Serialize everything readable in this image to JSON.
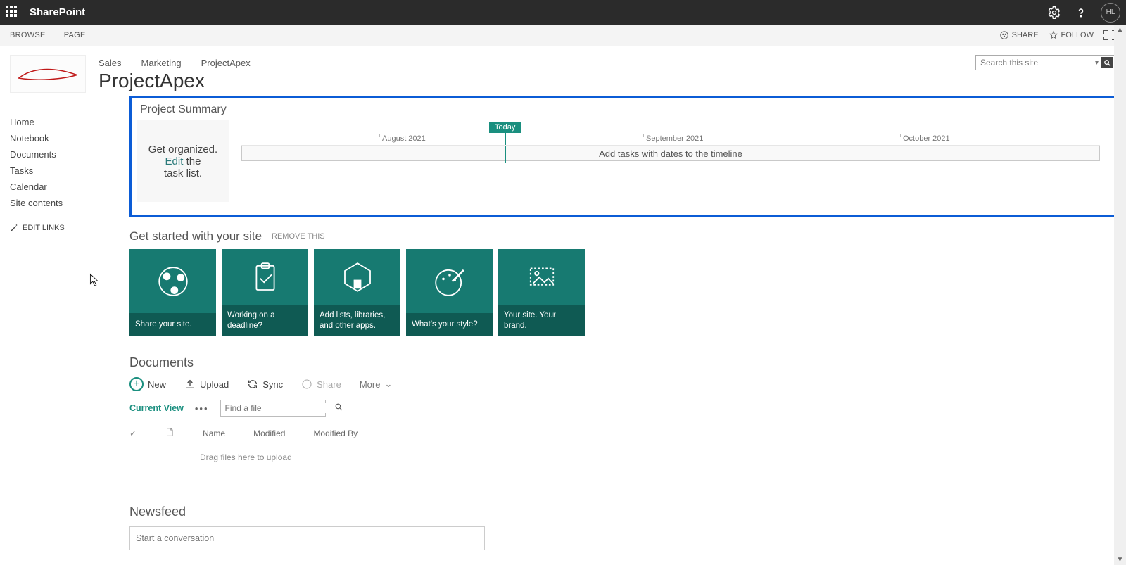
{
  "suite": {
    "brand": "SharePoint",
    "userInitials": "HL"
  },
  "ribbon": {
    "tabs": [
      "BROWSE",
      "PAGE"
    ],
    "share": "SHARE",
    "follow": "FOLLOW"
  },
  "topnav": {
    "items": [
      "Sales",
      "Marketing",
      "ProjectApex"
    ]
  },
  "siteTitle": "ProjectApex",
  "search": {
    "placeholder": "Search this site"
  },
  "leftnav": {
    "items": [
      "Home",
      "Notebook",
      "Documents",
      "Tasks",
      "Calendar",
      "Site contents"
    ],
    "editLinks": "EDIT LINKS"
  },
  "projectSummary": {
    "title": "Project Summary",
    "leftPanel": {
      "line1": "Get organized.",
      "editWord": "Edit",
      "after1": " the",
      "line3": "task list."
    },
    "today": "Today",
    "months": [
      "August 2021",
      "September 2021",
      "October 2021"
    ],
    "barText": "Add tasks with dates to the timeline"
  },
  "getStarted": {
    "title": "Get started with your site",
    "remove": "REMOVE THIS",
    "tiles": [
      "Share your site.",
      "Working on a deadline?",
      "Add lists, libraries, and other apps.",
      "What's your style?",
      "Your site. Your brand."
    ]
  },
  "documents": {
    "title": "Documents",
    "new": "New",
    "upload": "Upload",
    "sync": "Sync",
    "share": "Share",
    "more": "More",
    "currentView": "Current View",
    "findFile": "Find a file",
    "cols": {
      "name": "Name",
      "modified": "Modified",
      "modifiedBy": "Modified By"
    },
    "dropHint": "Drag files here to upload"
  },
  "newsfeed": {
    "title": "Newsfeed",
    "placeholder": "Start a conversation"
  }
}
